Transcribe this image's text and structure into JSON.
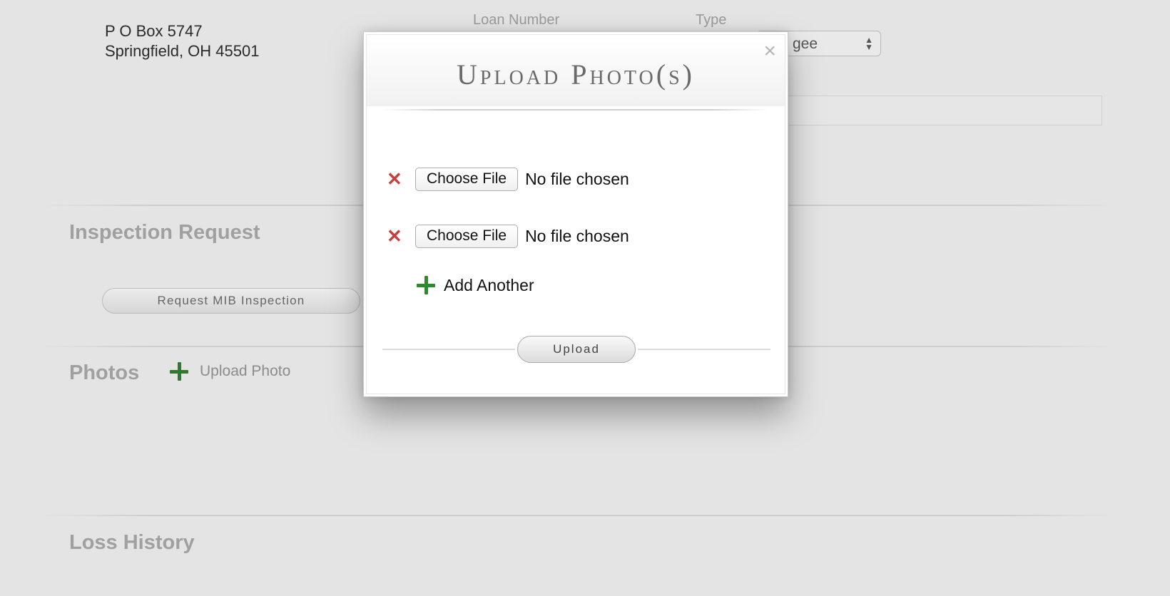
{
  "background": {
    "address": {
      "line1": "P O Box 5747",
      "line2": "Springfield, OH 45501"
    },
    "columns": {
      "loan_number_label": "Loan Number",
      "type_label": "Type"
    },
    "type_select": {
      "value_visible": "gee"
    },
    "sections": {
      "inspection_title": "Inspection Request",
      "request_mib_button": "Request MIB Inspection",
      "photos_title": "Photos",
      "upload_photo_link": "Upload Photo",
      "loss_history_title": "Loss History"
    }
  },
  "modal": {
    "title": "Upload Photo(s)",
    "close_glyph": "×",
    "file_rows": [
      {
        "button_label": "Choose File",
        "status": "No file chosen"
      },
      {
        "button_label": "Choose File",
        "status": "No file chosen"
      }
    ],
    "remove_glyph": "✕",
    "add_another_label": "Add Another",
    "upload_button_label": "Upload"
  },
  "colors": {
    "remove_red": "#c7403d",
    "plus_green": "#2f7a2c",
    "background": "#e4e4e4"
  }
}
